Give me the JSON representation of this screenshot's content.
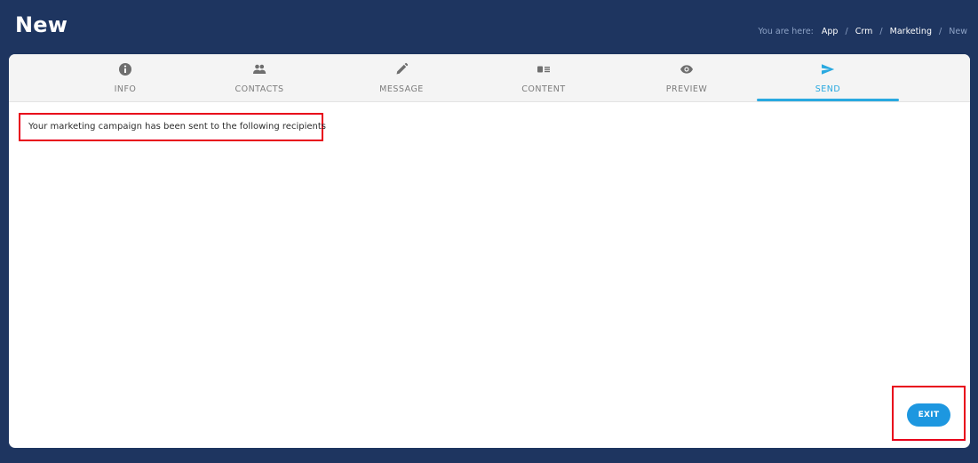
{
  "page": {
    "title": "New"
  },
  "breadcrumb": {
    "prefix": "You are here:",
    "items": [
      "App",
      "Crm",
      "Marketing",
      "New"
    ],
    "separator": "/"
  },
  "tabs": [
    {
      "label": "INFO",
      "icon": "info-icon",
      "active": false
    },
    {
      "label": "CONTACTS",
      "icon": "contacts-icon",
      "active": false
    },
    {
      "label": "MESSAGE",
      "icon": "pencil-icon",
      "active": false
    },
    {
      "label": "CONTENT",
      "icon": "content-icon",
      "active": false
    },
    {
      "label": "PREVIEW",
      "icon": "eye-icon",
      "active": false
    },
    {
      "label": "SEND",
      "icon": "send-icon",
      "active": true
    }
  ],
  "main": {
    "message": "Your marketing campaign has been sent to the following recipients"
  },
  "actions": {
    "exit_label": "EXIT"
  },
  "colors": {
    "background": "#1e3560",
    "accent": "#29a9e0",
    "button": "#1d97e0",
    "highlight": "#e8001a",
    "tab_bar": "#f4f4f4"
  }
}
